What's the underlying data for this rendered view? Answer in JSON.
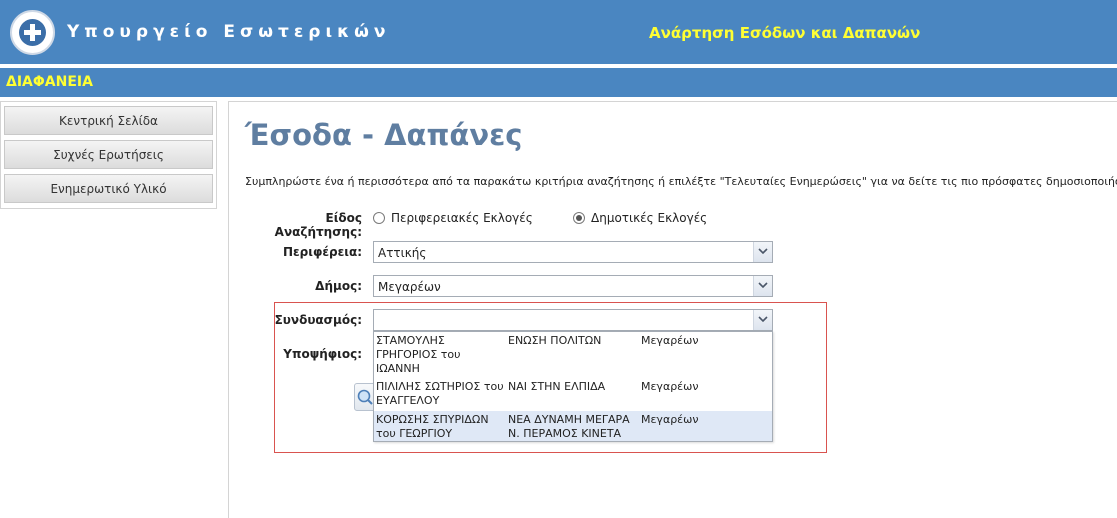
{
  "header": {
    "ministry": "Υπουργείο Εσωτερικών",
    "tagline": "Ανάρτηση Εσόδων και Δαπανών"
  },
  "subbar": {
    "label": "ΔΙΑΦΑΝΕΙΑ"
  },
  "sidebar": {
    "items": [
      {
        "label": "Κεντρική Σελίδα"
      },
      {
        "label": "Συχνές Ερωτήσεις"
      },
      {
        "label": "Ενημερωτικό Υλικό"
      }
    ]
  },
  "main": {
    "title": "Έσοδα - Δαπάνες",
    "intro": "Συμπληρώστε ένα ή περισσότερα από τα παρακάτω κριτήρια αναζήτησης ή επιλέξτε \"Τελευταίες Ενημερώσεις\" για να δείτε τις πιο πρόσφατες δημοσιοποιήσεις.",
    "search_type": {
      "label": "Είδος Αναζήτησης:",
      "options": [
        {
          "label": "Περιφερειακές Εκλογές",
          "checked": false
        },
        {
          "label": "Δημοτικές Εκλογές",
          "checked": true
        }
      ]
    },
    "region": {
      "label": "Περιφέρεια:",
      "value": "Αττικής"
    },
    "municipality": {
      "label": "Δήμος:",
      "value": "Μεγαρέων"
    },
    "coalition": {
      "label": "Συνδυασμός:",
      "value": "",
      "options": [
        {
          "candidate": "ΣΤΑΜΟΥΛΗΣ ΓΡΗΓΟΡΙΟΣ του ΙΩΑΝΝΗ",
          "party": "ΕΝΩΣΗ ΠΟΛΙΤΩΝ",
          "municipality": "Μεγαρέων"
        },
        {
          "candidate": "ΠΙΛΙΛΗΣ ΣΩΤΗΡΙΟΣ του ΕΥΑΓΓΕΛΟΥ",
          "party": "ΝΑΙ ΣΤΗΝ ΕΛΠΙΔΑ",
          "municipality": "Μεγαρέων"
        },
        {
          "candidate": "ΚΟΡΩΣΗΣ ΣΠΥΡΙΔΩΝ του ΓΕΩΡΓΙΟΥ",
          "party": "ΝΕΑ ΔΥΝΑΜΗ ΜΕΓΑΡΑ Ν. ΠΕΡΑΜΟΣ ΚΙΝΕΤΑ",
          "municipality": "Μεγαρέων"
        }
      ]
    },
    "candidate": {
      "label": "Υποψήφιος:"
    },
    "icons": {
      "dropdown": "chevron-down-icon",
      "search": "search-icon",
      "seal": "seal-icon"
    }
  }
}
